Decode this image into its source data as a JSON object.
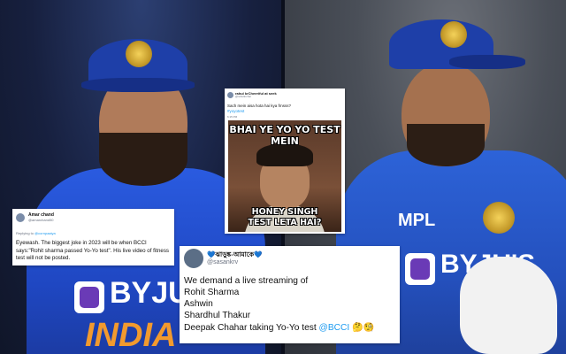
{
  "card1": {
    "name": "Amar chand",
    "handle": "@amarchand50",
    "reply_prefix": "Replying to ",
    "reply_to": "@cornpaaiya",
    "body": "Eyewash. The biggest joke in 2023 will be when BCCI says:\"Rohit sharma passed Yo-Yo test\". His live video of fitness test will not be posted."
  },
  "card2": {
    "name": "rahul krCheeriful at seek",
    "handle": "@rahulkrchar",
    "body": "Sach mein aisa hota hai kya frnsss?",
    "tag": "#yoyotest",
    "time": "6:15 PM",
    "meme_top": "BHAI YE YO YO TEST MEIN",
    "meme_bottom_1": "HONEY SINGH",
    "meme_bottom_2": "TEST LETA HAI?"
  },
  "card3": {
    "name": "💙ঝাড়ুঙ্ক-আমাকে💙",
    "handle": "@sasankrv",
    "lines": [
      "We demand a live streaming of",
      "Rohit Sharma",
      "Ashwin",
      "Shardhul Thakur"
    ],
    "last_line_text": "Deepak Chahar taking Yo-Yo test ",
    "mention": "@BCCI",
    "emojis": "🤔🧐"
  },
  "photo": {
    "left_jersey_text": "BYJU'S",
    "left_jersey_country": "INDIA",
    "right_jersey_sponsor": "MPL",
    "right_jersey_text": "BYJU'S"
  }
}
